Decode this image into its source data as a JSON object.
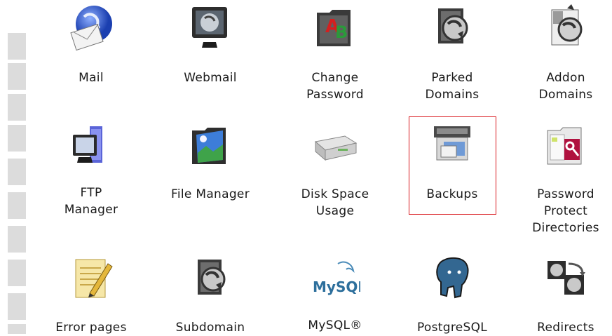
{
  "items": [
    {
      "key": "mail",
      "label": "Mail",
      "icon": "mail-globe-icon"
    },
    {
      "key": "webmail",
      "label": "Webmail",
      "icon": "webmail-monitor-icon"
    },
    {
      "key": "change_password",
      "label": "Change\nPassword",
      "icon": "change-password-folder-icon"
    },
    {
      "key": "parked_domains",
      "label": "Parked\nDomains",
      "icon": "parked-domains-icon"
    },
    {
      "key": "addon_domains",
      "label": "Addon\nDomains",
      "icon": "addon-domains-icon"
    },
    {
      "key": "ftp_manager",
      "label": "FTP\nManager",
      "icon": "ftp-computer-icon"
    },
    {
      "key": "file_manager",
      "label": "File Manager",
      "icon": "file-manager-folder-icon"
    },
    {
      "key": "disk_space_usage",
      "label": "Disk Space\nUsage",
      "icon": "hard-disk-icon"
    },
    {
      "key": "backups",
      "label": "Backups",
      "icon": "backup-drive-icon"
    },
    {
      "key": "password_protect",
      "label": "Password\nProtect\nDirectories",
      "icon": "password-protect-folder-icon"
    },
    {
      "key": "error_pages",
      "label": "Error pages",
      "icon": "notepad-pencil-icon"
    },
    {
      "key": "subdomain",
      "label": "Subdomain",
      "icon": "subdomain-icon"
    },
    {
      "key": "mysql",
      "label": "MySQL®",
      "icon": "mysql-logo-icon"
    },
    {
      "key": "postgresql",
      "label": "PostgreSQL",
      "icon": "postgresql-elephant-icon"
    },
    {
      "key": "redirects",
      "label": "Redirects",
      "icon": "redirects-icon"
    }
  ],
  "logo_text": {
    "mysql": "MySQL"
  },
  "highlight": {
    "target": "backups",
    "color": "#d9181e"
  },
  "colors": {
    "sidebar": "#dcdcdc",
    "text": "#1a1a1a"
  }
}
